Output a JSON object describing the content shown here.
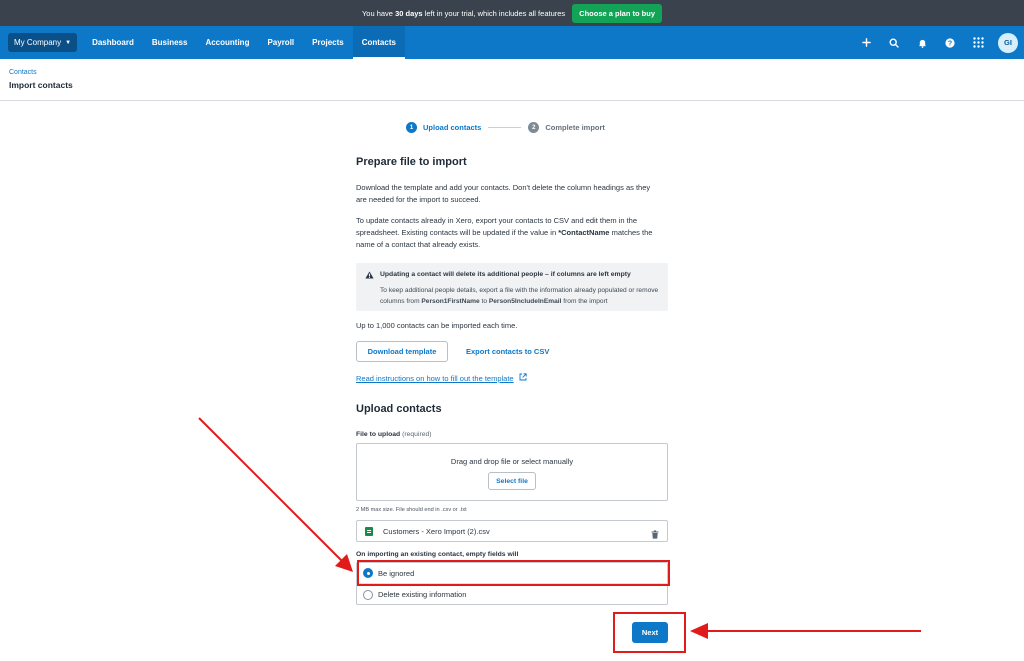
{
  "trial": {
    "prefix": "You have ",
    "days": "30 days",
    "suffix": " left in your trial, which includes all features",
    "cta": "Choose a plan to buy"
  },
  "nav": {
    "org": "My Company",
    "items": [
      "Dashboard",
      "Business",
      "Accounting",
      "Payroll",
      "Projects",
      "Contacts"
    ],
    "active": "Contacts",
    "avatar_initials": "GI",
    "icons": [
      "plus-icon",
      "search-icon",
      "bell-icon",
      "help-icon",
      "apps-grid-icon"
    ]
  },
  "page": {
    "breadcrumb": "Contacts",
    "title": "Import contacts"
  },
  "stepper": {
    "steps": [
      {
        "num": "1",
        "label": "Upload contacts"
      },
      {
        "num": "2",
        "label": "Complete import"
      }
    ]
  },
  "prepare": {
    "heading": "Prepare file to import",
    "p1": "Download the template and add your contacts. Don't delete the column headings as they are needed for the import to succeed.",
    "p2_a": "To update contacts already in Xero, export your contacts to CSV and edit them in the spreadsheet. Existing contacts will be updated if the value in ",
    "p2_b": "*ContactName",
    "p2_c": " matches the name of a contact that already exists.",
    "warning_title": "Updating a contact will delete its additional people – if columns are left empty",
    "warning_a": "To keep additional people details, export a file with the information already populated or remove columns from ",
    "warning_b": "Person1FirstName",
    "warning_c": " to ",
    "warning_d": "Person5IncludeInEmail",
    "warning_e": " from the import",
    "limit": "Up to 1,000 contacts can be imported each time.",
    "download_btn": "Download template",
    "export_link": "Export contacts to CSV",
    "instructions_link": "Read instructions on how to fill out the template"
  },
  "upload": {
    "heading": "Upload contacts",
    "file_label": "File to upload",
    "file_required": "(required)",
    "drop_text": "Drag and drop file or select manually",
    "select_btn": "Select file",
    "hint": "2 MB max size. File should end in .csv or .txt",
    "file_name": "Customers - Xero Import (2).csv",
    "empty_fields_label": "On importing an existing contact, empty fields will",
    "options": [
      "Be ignored",
      "Delete existing information"
    ],
    "selected": "Be ignored",
    "next_btn": "Next"
  },
  "colors": {
    "nav_blue": "#0d78c8",
    "trial_bg": "#3a434d",
    "cta_green": "#13a357",
    "annotation_red": "#e11b1b"
  }
}
